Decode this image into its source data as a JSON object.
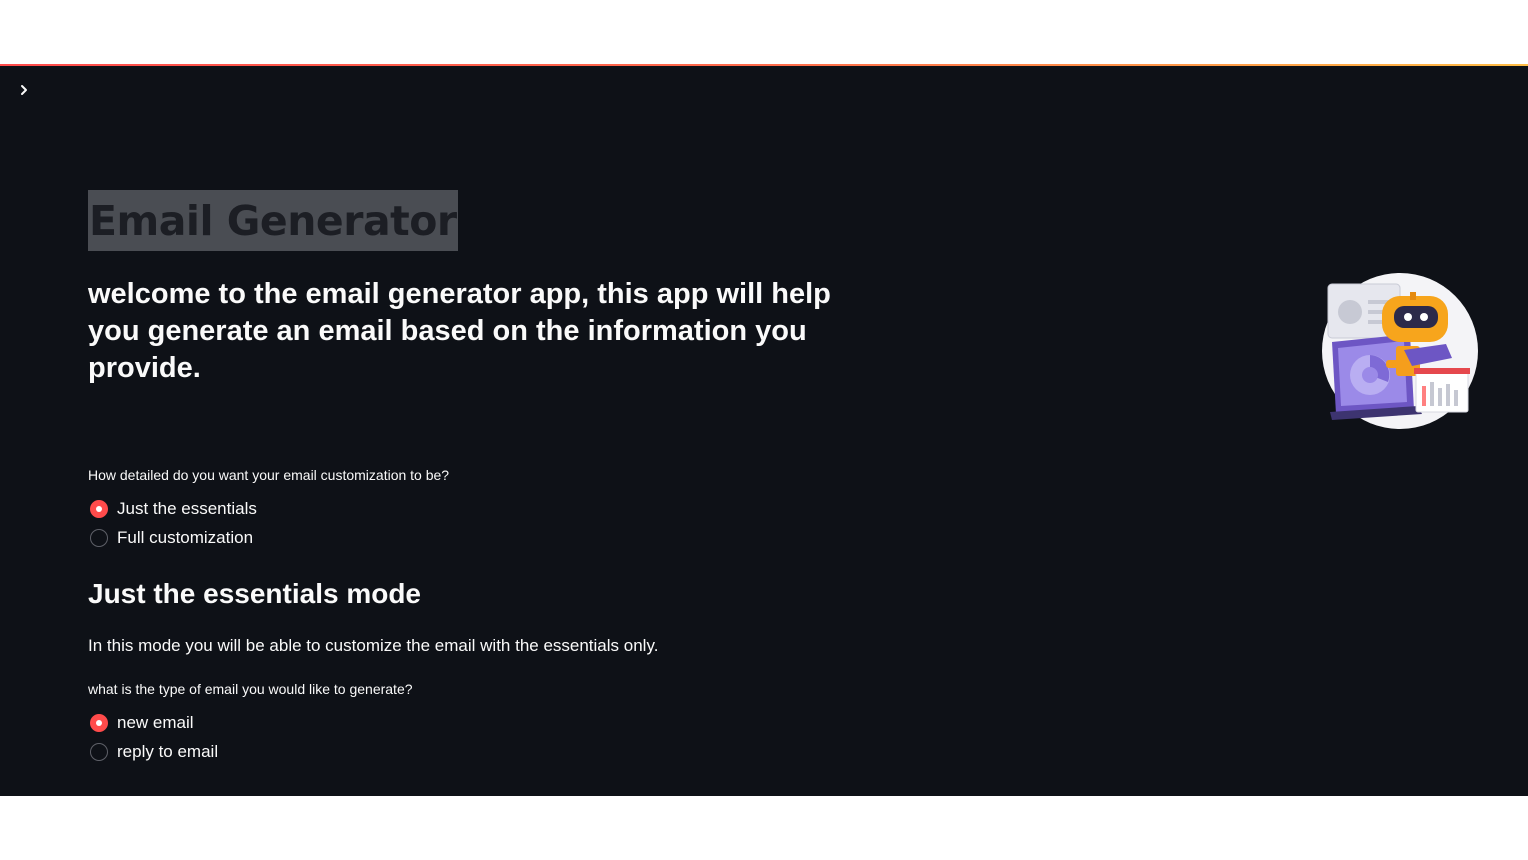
{
  "app": {
    "title": "Email Generator",
    "welcome": "welcome to the email generator app, this app will help you generate an email based on the information you provide.",
    "colors": {
      "background": "#0e1117",
      "text": "#fafafa",
      "accent": "#ff4b4b",
      "title_highlight": "#4a4d53"
    }
  },
  "sidebar": {
    "toggle_icon": "chevron-right-icon"
  },
  "illustration": {
    "icon": "robot-laptop-illustration"
  },
  "customization": {
    "question": "How detailed do you want your email customization to be?",
    "options": [
      "Just the essentials",
      "Full customization"
    ],
    "selected": "Just the essentials"
  },
  "mode": {
    "title": "Just the essentials mode",
    "description": "In this mode you will be able to customize the email with the essentials only."
  },
  "email_type": {
    "question": "what is the type of email you would like to generate?",
    "options": [
      "new email",
      "reply to email"
    ],
    "selected": "new email"
  }
}
